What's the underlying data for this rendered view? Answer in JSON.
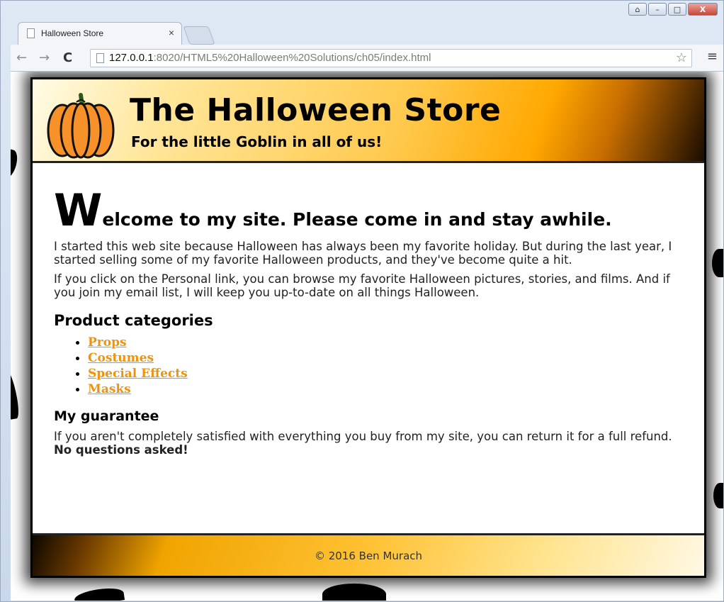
{
  "browser": {
    "tab_title": "Halloween Store",
    "tab_close": "×",
    "url_host": "127.0.0.1",
    "url_path": ":8020/HTML5%20Halloween%20Solutions/ch05/index.html",
    "back": "←",
    "forward": "→",
    "reload": "C",
    "star": "☆",
    "menu": "≡",
    "window_buttons": {
      "minimize": "–",
      "maximize": "□",
      "close": "X",
      "user": "⌂"
    }
  },
  "header": {
    "title": "The Halloween Store",
    "tagline": "For the little Goblin in all of us!"
  },
  "main": {
    "welcome_dropcap": "W",
    "welcome_rest": "elcome to my site. Please come in and stay awhile.",
    "paragraphs": [
      "I started this web site because Halloween has always been my favorite holiday. But during the last year, I started selling some of my favorite Halloween products, and they've become quite a hit.",
      "If you click on the Personal link, you can browse my favorite Halloween pictures, stories, and films. And if you join my email list, I will keep you up-to-date on all things Halloween."
    ],
    "categories_heading": "Product categories",
    "categories": [
      "Props",
      "Costumes",
      "Special Effects",
      "Masks"
    ],
    "guarantee_heading": "My guarantee",
    "guarantee_text": "If you aren't completely satisfied with everything you buy from my site, you can return it for a full refund.",
    "guarantee_bold": "No questions asked!"
  },
  "footer": {
    "text": "© 2016 Ben Murach"
  },
  "colors": {
    "link": "#f0920a",
    "header_accent": "#ffa800"
  }
}
